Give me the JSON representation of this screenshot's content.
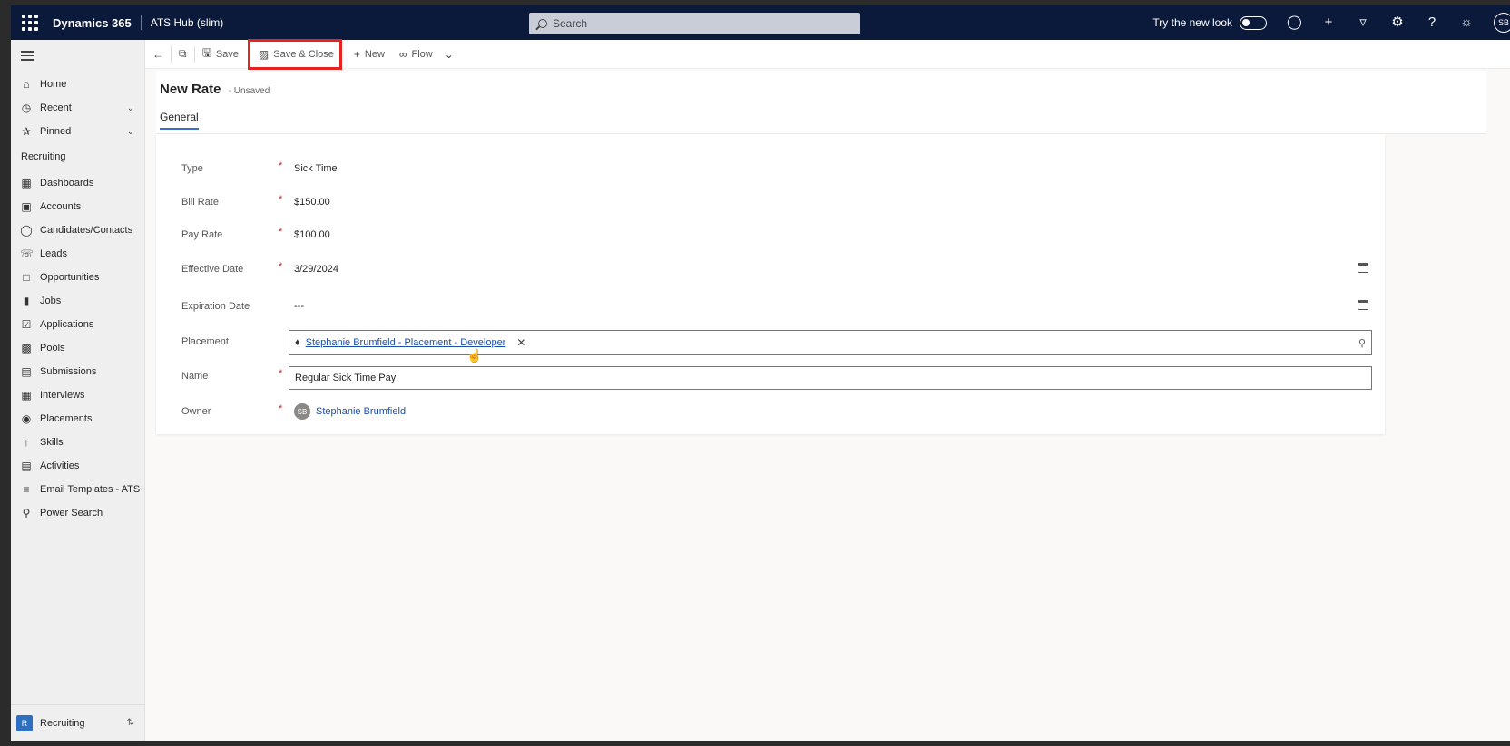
{
  "topbar": {
    "brand": "Dynamics 365",
    "app_name": "ATS Hub (slim)",
    "search_placeholder": "Search",
    "try_new_look": "Try the new look",
    "avatar_initials": "SB"
  },
  "sidebar": {
    "items_top": [
      {
        "label": "Home",
        "icon": "home-icon"
      },
      {
        "label": "Recent",
        "icon": "clock-icon"
      },
      {
        "label": "Pinned",
        "icon": "pin-icon"
      }
    ],
    "section": "Recruiting",
    "items": [
      {
        "label": "Dashboards",
        "icon": "dashboard-icon"
      },
      {
        "label": "Accounts",
        "icon": "accounts-icon"
      },
      {
        "label": "Candidates/Contacts",
        "icon": "person-icon"
      },
      {
        "label": "Leads",
        "icon": "phone-icon"
      },
      {
        "label": "Opportunities",
        "icon": "clipboard-icon"
      },
      {
        "label": "Jobs",
        "icon": "briefcase-icon"
      },
      {
        "label": "Applications",
        "icon": "check-icon"
      },
      {
        "label": "Pools",
        "icon": "pools-icon"
      },
      {
        "label": "Submissions",
        "icon": "submissions-icon"
      },
      {
        "label": "Interviews",
        "icon": "calendar-icon"
      },
      {
        "label": "Placements",
        "icon": "placements-icon"
      },
      {
        "label": "Skills",
        "icon": "skills-icon"
      },
      {
        "label": "Activities",
        "icon": "activities-icon"
      },
      {
        "label": "Email Templates - ATS",
        "icon": "layers-icon"
      },
      {
        "label": "Power Search",
        "icon": "search-icon"
      }
    ],
    "area": {
      "badge": "R",
      "label": "Recruiting"
    }
  },
  "commandbar": {
    "save": "Save",
    "save_close": "Save & Close",
    "new": "New",
    "flow": "Flow"
  },
  "header": {
    "title": "New Rate",
    "status": "- Unsaved",
    "tab": "General"
  },
  "form": {
    "type": {
      "label": "Type",
      "value": "Sick Time"
    },
    "bill_rate": {
      "label": "Bill Rate",
      "value": "$150.00"
    },
    "pay_rate": {
      "label": "Pay Rate",
      "value": "$100.00"
    },
    "effective_date": {
      "label": "Effective Date",
      "value": "3/29/2024"
    },
    "expiration_date": {
      "label": "Expiration Date",
      "value": "---"
    },
    "placement": {
      "label": "Placement",
      "value": "Stephanie Brumfield - Placement - Developer"
    },
    "name": {
      "label": "Name",
      "value": "Regular Sick Time Pay"
    },
    "owner": {
      "label": "Owner",
      "value": "Stephanie Brumfield",
      "initials": "SB"
    },
    "required_mark": "*"
  },
  "colors": {
    "topbar": "#0b1a3a",
    "highlight": "#e52421",
    "link": "#1c4fa8",
    "required": "#c4262e"
  }
}
